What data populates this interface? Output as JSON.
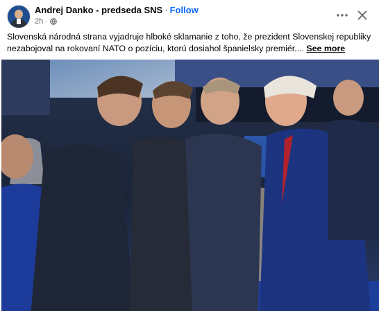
{
  "post": {
    "author": "Andrej Danko - predseda SNS",
    "separator": "·",
    "follow_label": "Follow",
    "time": "2h",
    "meta_separator": "·",
    "audience_icon": "globe-icon",
    "text": "Slovenská národná strana vyjadruje hlboké sklamanie z toho, že prezident Slovenskej republiky nezabojoval na rokovaní NATO o pozíciu, ktorú dosiahol španielsky premiér.... ",
    "see_more_label": "See more"
  },
  "icons": {
    "more": "more-horizontal-icon",
    "close": "close-icon"
  },
  "colors": {
    "link": "#0866ff",
    "secondary_text": "#65676b",
    "stage_blue": "#1a3d8f"
  }
}
